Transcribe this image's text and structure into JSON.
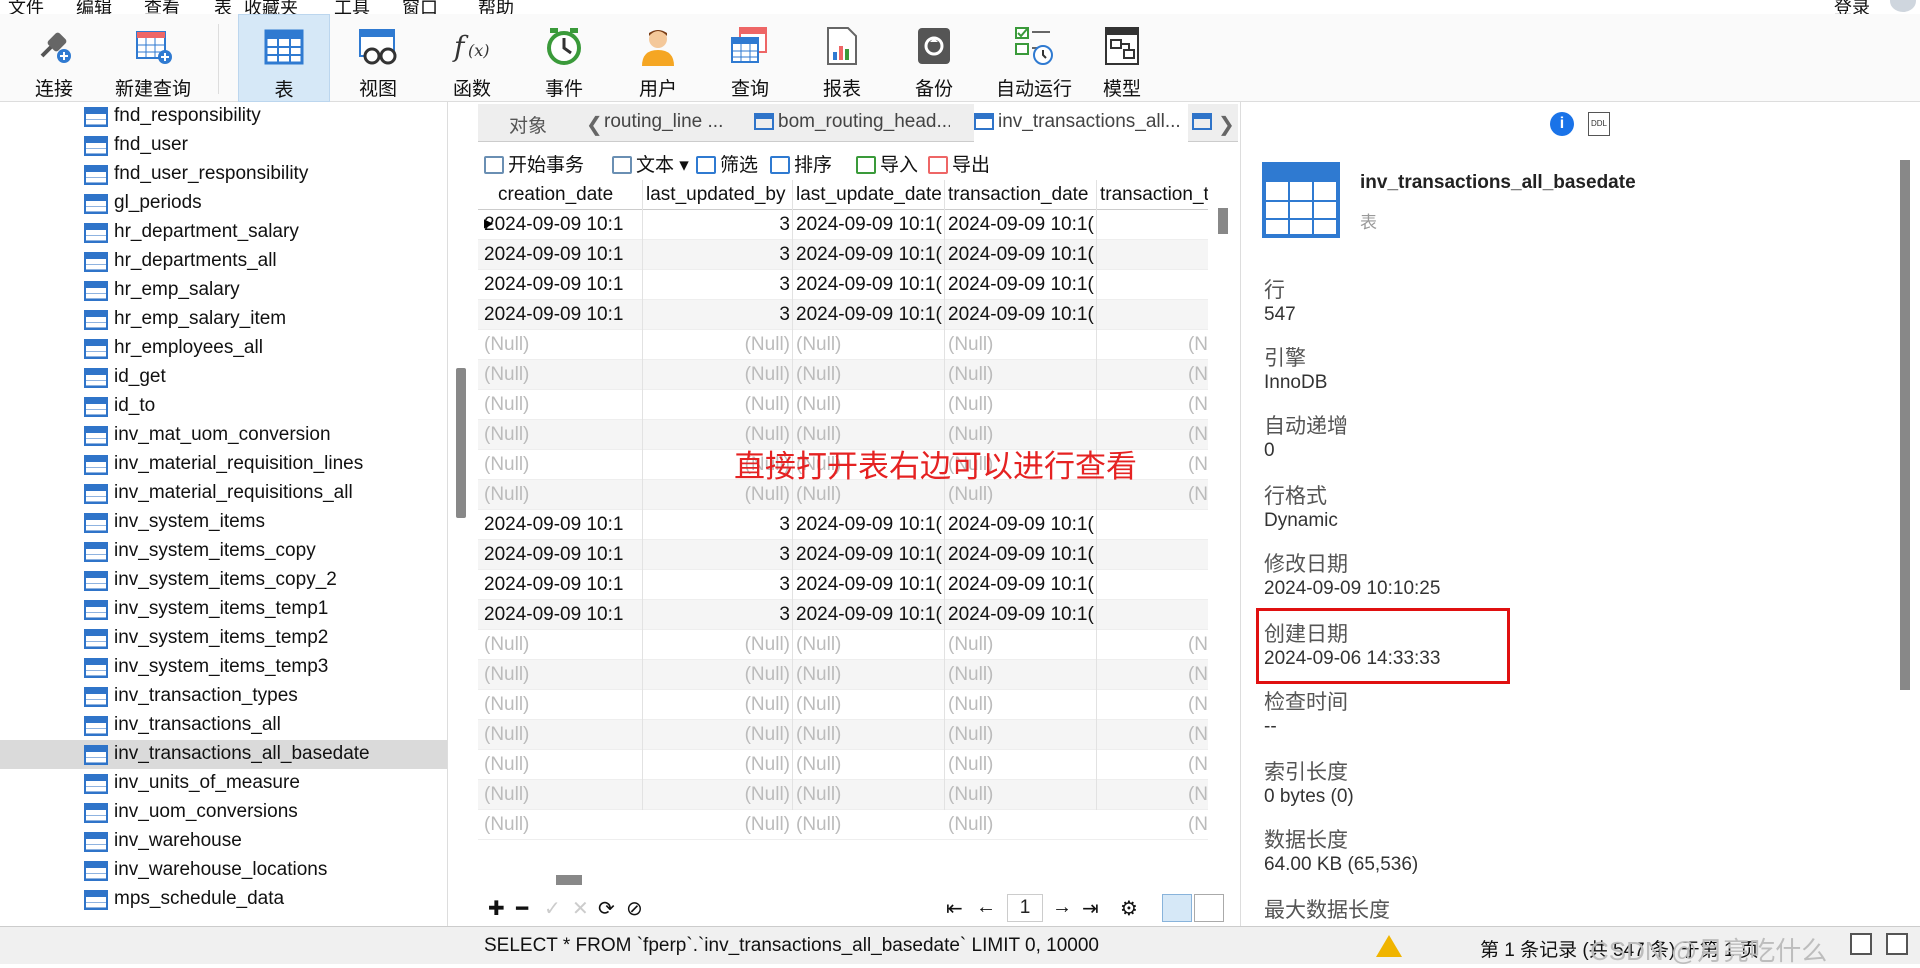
{
  "menu": {
    "items": [
      "文件",
      "编辑",
      "查看",
      "表",
      "收藏夹",
      "工具",
      "窗口",
      "帮助"
    ],
    "login": "登录"
  },
  "toolbar": {
    "items": [
      {
        "label": "连接",
        "icon": "plug-icon"
      },
      {
        "label": "新建查询",
        "icon": "new-query-icon"
      },
      {
        "label": "表",
        "icon": "table-icon",
        "active": true
      },
      {
        "label": "视图",
        "icon": "view-icon"
      },
      {
        "label": "函数",
        "icon": "function-icon"
      },
      {
        "label": "事件",
        "icon": "clock-icon"
      },
      {
        "label": "用户",
        "icon": "user-icon"
      },
      {
        "label": "查询",
        "icon": "query-icon"
      },
      {
        "label": "报表",
        "icon": "report-icon"
      },
      {
        "label": "备份",
        "icon": "backup-icon"
      },
      {
        "label": "自动运行",
        "icon": "autorun-icon"
      },
      {
        "label": "模型",
        "icon": "model-icon"
      }
    ]
  },
  "tree": {
    "items": [
      "fnd_responsibility",
      "fnd_user",
      "fnd_user_responsibility",
      "gl_periods",
      "hr_department_salary",
      "hr_departments_all",
      "hr_emp_salary",
      "hr_emp_salary_item",
      "hr_employees_all",
      "id_get",
      "id_to",
      "inv_mat_uom_conversion",
      "inv_material_requisition_lines",
      "inv_material_requisitions_all",
      "inv_system_items",
      "inv_system_items_copy",
      "inv_system_items_copy_2",
      "inv_system_items_temp1",
      "inv_system_items_temp2",
      "inv_system_items_temp3",
      "inv_transaction_types",
      "inv_transactions_all",
      "inv_transactions_all_basedate",
      "inv_units_of_measure",
      "inv_uom_conversions",
      "inv_warehouse",
      "inv_warehouse_locations",
      "mps_schedule_data"
    ],
    "selected": "inv_transactions_all_basedate"
  },
  "tabs": {
    "objects": "对象",
    "items": [
      "routing_line ...",
      "bom_routing_head...",
      "inv_transactions_all..."
    ]
  },
  "actions": {
    "begin_tx": "开始事务",
    "text": "文本",
    "filter": "筛选",
    "sort": "排序",
    "import": "导入",
    "export": "导出"
  },
  "grid": {
    "columns": [
      "creation_date",
      "last_updated_by",
      "last_update_date",
      "transaction_date",
      "transaction_t"
    ],
    "rows": [
      [
        "2024-09-09 10:1",
        "3",
        "2024-09-09 10:1(",
        "2024-09-09 10:1(",
        ""
      ],
      [
        "2024-09-09 10:1",
        "3",
        "2024-09-09 10:1(",
        "2024-09-09 10:1(",
        ""
      ],
      [
        "2024-09-09 10:1",
        "3",
        "2024-09-09 10:1(",
        "2024-09-09 10:1(",
        ""
      ],
      [
        "2024-09-09 10:1",
        "3",
        "2024-09-09 10:1(",
        "2024-09-09 10:1(",
        ""
      ],
      [
        "(Null)",
        "(Null)",
        "(Null)",
        "(Null)",
        "(N"
      ],
      [
        "(Null)",
        "(Null)",
        "(Null)",
        "(Null)",
        "(N"
      ],
      [
        "(Null)",
        "(Null)",
        "(Null)",
        "(Null)",
        "(N"
      ],
      [
        "(Null)",
        "(Null)",
        "(Null)",
        "(Null)",
        "(N"
      ],
      [
        "(Null)",
        "(Null)",
        "(Null)",
        "(Null)",
        "(N"
      ],
      [
        "(Null)",
        "(Null)",
        "(Null)",
        "(Null)",
        "(N"
      ],
      [
        "2024-09-09 10:1",
        "3",
        "2024-09-09 10:1(",
        "2024-09-09 10:1(",
        ""
      ],
      [
        "2024-09-09 10:1",
        "3",
        "2024-09-09 10:1(",
        "2024-09-09 10:1(",
        ""
      ],
      [
        "2024-09-09 10:1",
        "3",
        "2024-09-09 10:1(",
        "2024-09-09 10:1(",
        ""
      ],
      [
        "2024-09-09 10:1",
        "3",
        "2024-09-09 10:1(",
        "2024-09-09 10:1(",
        ""
      ],
      [
        "(Null)",
        "(Null)",
        "(Null)",
        "(Null)",
        "(N"
      ],
      [
        "(Null)",
        "(Null)",
        "(Null)",
        "(Null)",
        "(N"
      ],
      [
        "(Null)",
        "(Null)",
        "(Null)",
        "(Null)",
        "(N"
      ],
      [
        "(Null)",
        "(Null)",
        "(Null)",
        "(Null)",
        "(N"
      ],
      [
        "(Null)",
        "(Null)",
        "(Null)",
        "(Null)",
        "(N"
      ],
      [
        "(Null)",
        "(Null)",
        "(Null)",
        "(Null)",
        "(N"
      ],
      [
        "(Null)",
        "(Null)",
        "(Null)",
        "(Null)",
        "(N"
      ]
    ]
  },
  "annotation": "直接打开表右边可以进行查看",
  "pager": {
    "page": "1"
  },
  "status": {
    "sql": "SELECT * FROM `fperp`.`inv_transactions_all_basedate` LIMIT 0, 10000",
    "records": "第 1 条记录 (共 547 条) 于第 1 页",
    "watermark": "CSDN @月亮吃什么"
  },
  "info": {
    "table_name": "inv_transactions_all_basedate",
    "type": "表",
    "ddl": "DDL",
    "props": [
      {
        "key": "行",
        "value": "547"
      },
      {
        "key": "引擎",
        "value": "InnoDB"
      },
      {
        "key": "自动递增",
        "value": "0"
      },
      {
        "key": "行格式",
        "value": "Dynamic"
      },
      {
        "key": "修改日期",
        "value": "2024-09-09 10:10:25"
      },
      {
        "key": "创建日期",
        "value": "2024-09-06 14:33:33"
      },
      {
        "key": "检查时间",
        "value": "--"
      },
      {
        "key": "索引长度",
        "value": "0 bytes (0)"
      },
      {
        "key": "数据长度",
        "value": "64.00 KB (65,536)"
      },
      {
        "key": "最大数据长度",
        "value": ""
      }
    ]
  }
}
